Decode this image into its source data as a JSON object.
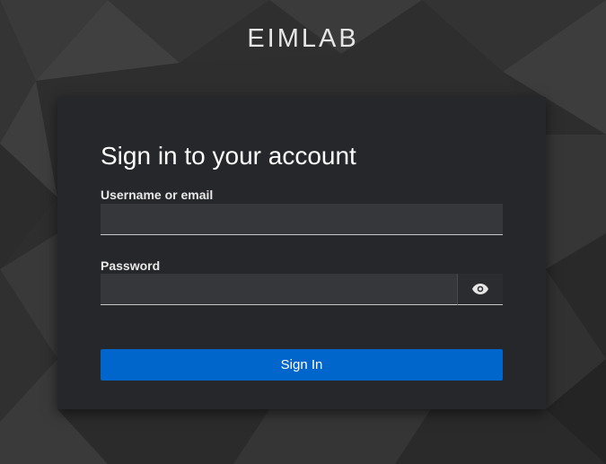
{
  "brand": {
    "name": "EIMLAB"
  },
  "login": {
    "title": "Sign in to your account",
    "username_label": "Username or email",
    "username_value": "",
    "password_label": "Password",
    "password_value": "",
    "show_password_icon": "eye-icon",
    "signin_label": "Sign In"
  },
  "colors": {
    "background": "#2f2f2f",
    "card": "#26272b",
    "input": "#36373b",
    "accent": "#0066cc"
  }
}
